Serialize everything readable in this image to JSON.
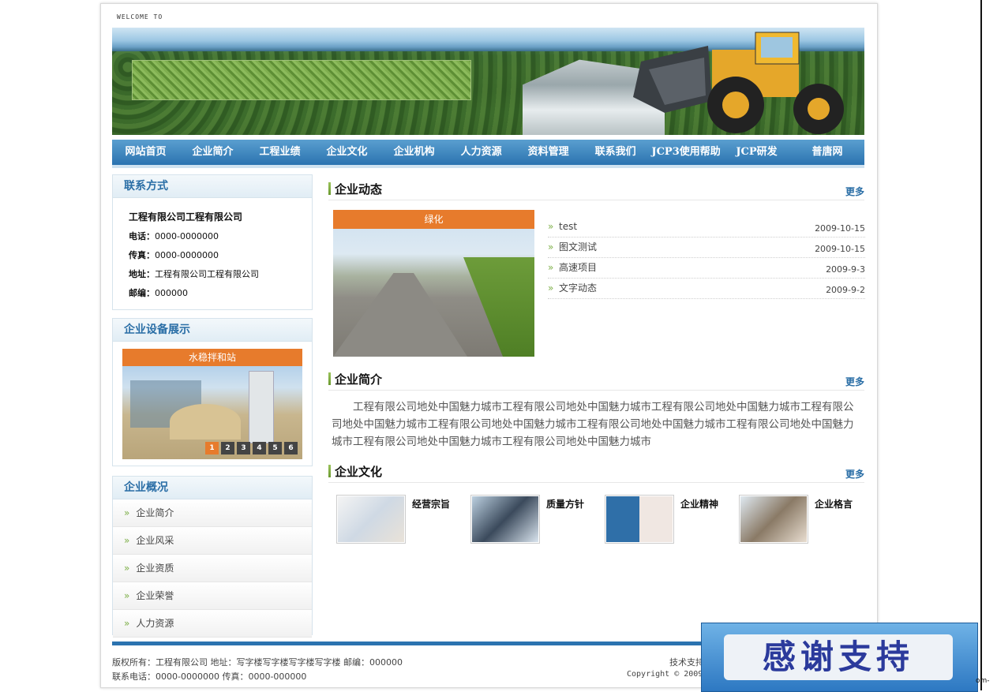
{
  "header": {
    "welcome": "WELCOME TO"
  },
  "nav": [
    "网站首页",
    "企业简介",
    "工程业绩",
    "企业文化",
    "企业机构",
    "人力资源",
    "资料管理",
    "联系我们",
    "JCP3使用帮助",
    "JCP研发",
    "普唐网"
  ],
  "contact": {
    "title": "联系方式",
    "company": "工程有限公司工程有限公司",
    "rows": [
      {
        "label": "电话：",
        "value": "0000-0000000"
      },
      {
        "label": "传真：",
        "value": "0000-0000000"
      },
      {
        "label": "地址：",
        "value": "工程有限公司工程有限公司"
      },
      {
        "label": "邮编：",
        "value": "000000"
      }
    ]
  },
  "equipment": {
    "title": "企业设备展示",
    "caption": "水稳拌和站",
    "pages": [
      "1",
      "2",
      "3",
      "4",
      "5",
      "6"
    ]
  },
  "overview": {
    "title": "企业概况",
    "items": [
      "企业简介",
      "企业风采",
      "企业资质",
      "企业荣誉",
      "人力资源"
    ]
  },
  "news": {
    "title": "企业动态",
    "more": "更多",
    "photo_caption": "绿化",
    "items": [
      {
        "text": "test",
        "date": "2009-10-15"
      },
      {
        "text": "图文测试",
        "date": "2009-10-15"
      },
      {
        "text": "高速项目",
        "date": "2009-9-3"
      },
      {
        "text": "文字动态",
        "date": "2009-9-2"
      }
    ]
  },
  "about": {
    "title": "企业简介",
    "more": "更多",
    "text": "工程有限公司地处中国魅力城市工程有限公司地处中国魅力城市工程有限公司地处中国魅力城市工程有限公司地处中国魅力城市工程有限公司地处中国魅力城市工程有限公司地处中国魅力城市工程有限公司地处中国魅力城市工程有限公司地处中国魅力城市工程有限公司地处中国魅力城市"
  },
  "culture": {
    "title": "企业文化",
    "more": "更多",
    "cards": [
      "经营宗旨",
      "质量方针",
      "企业精神",
      "企业格言"
    ]
  },
  "footer": {
    "line1": "版权所有：工程有限公司   地址：写字楼写字楼写字楼写字楼   邮编：000000",
    "line2": "联系电话：0000-0000000   传真：0000-000000",
    "right1": "技术支持",
    "right2": "Copyright © 2009"
  },
  "overlay": {
    "thanks": "感谢支持",
    "corner": "om-"
  },
  "colors": {
    "nav": "#2b73b0",
    "accent": "#e77b2c",
    "title_blue": "#2a6ea6"
  }
}
